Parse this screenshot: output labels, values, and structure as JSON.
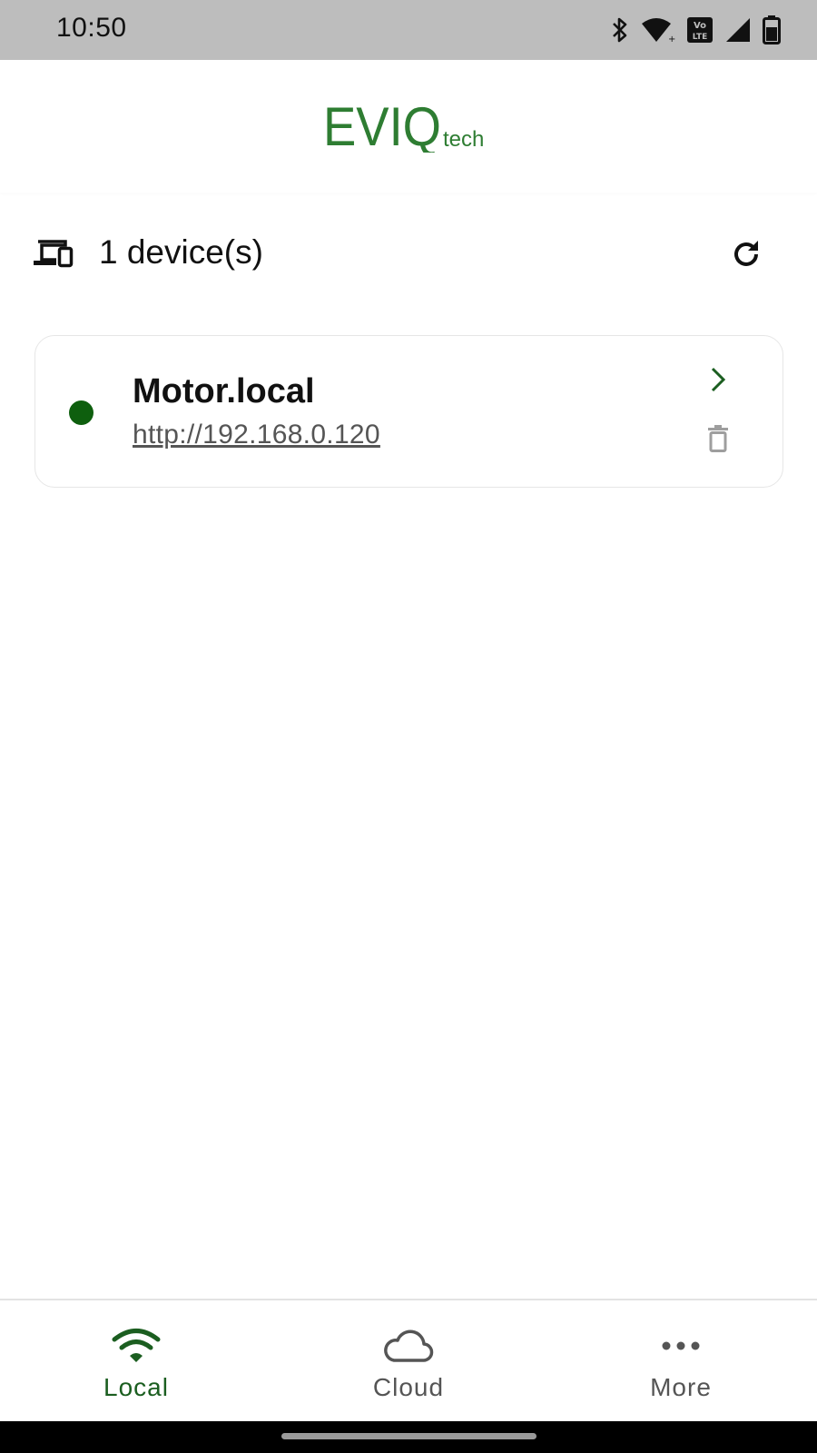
{
  "status_bar": {
    "time": "10:50",
    "icons": [
      "bluetooth-icon",
      "wifi-icon",
      "volte-icon",
      "cellular-signal-icon",
      "battery-icon"
    ],
    "volte_top": "Vo",
    "volte_bottom": "LTE"
  },
  "header": {
    "logo_main": "EVIQ",
    "logo_sub": "tech",
    "logo_color": "#2e7d32"
  },
  "devices": {
    "count_label": "1 device(s)",
    "list": [
      {
        "name": "Motor.local",
        "url": "http://192.168.0.120",
        "online": true,
        "status_color": "#0e5f0e"
      }
    ]
  },
  "bottom_nav": {
    "items": [
      {
        "label": "Local",
        "icon": "wifi-icon",
        "active": true
      },
      {
        "label": "Cloud",
        "icon": "cloud-icon",
        "active": false
      },
      {
        "label": "More",
        "icon": "more-horizontal-icon",
        "active": false
      }
    ],
    "active_color": "#1b5e20"
  }
}
